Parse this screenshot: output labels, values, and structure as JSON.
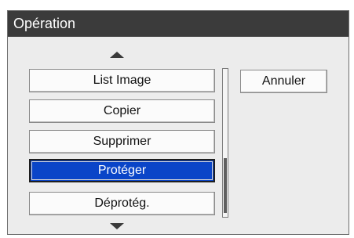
{
  "dialog": {
    "title": "Opération"
  },
  "menu": {
    "items": [
      {
        "label": "List Image",
        "selected": false
      },
      {
        "label": "Copier",
        "selected": false
      },
      {
        "label": "Supprimer",
        "selected": false
      },
      {
        "label": "Protéger",
        "selected": true
      },
      {
        "label": "Déprotég.",
        "selected": false
      }
    ]
  },
  "actions": {
    "cancel_label": "Annuler"
  },
  "icons": {
    "scroll_up": "triangle-up-icon",
    "scroll_down": "triangle-down-icon"
  },
  "colors": {
    "title_bar": "#3b3b3b",
    "selected_item": "#0a45c8",
    "panel_background": "#ececec"
  }
}
